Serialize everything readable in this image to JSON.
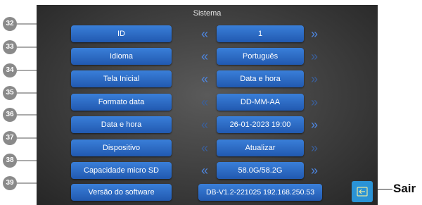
{
  "screen": {
    "title": "Sistema"
  },
  "rows": [
    {
      "callout": "32",
      "label": "ID",
      "value": "1"
    },
    {
      "callout": "33",
      "label": "Idioma",
      "value": "Português"
    },
    {
      "callout": "34",
      "label": "Tela Inicial",
      "value": "Data e hora"
    },
    {
      "callout": "35",
      "label": "Formato data",
      "value": "DD-MM-AA"
    },
    {
      "callout": "36",
      "label": "Data e hora",
      "value": "26-01-2023 19:00"
    },
    {
      "callout": "37",
      "label": "Dispositivo",
      "value": "Atualizar"
    },
    {
      "callout": "38",
      "label": "Capacidade micro SD",
      "value": "58.0G/58.2G"
    },
    {
      "callout": "39",
      "label": "Versão do software",
      "value": "DB-V1.2-221025 192.168.250.53"
    }
  ],
  "arrows": {
    "left": "«",
    "right": "»"
  },
  "exit": {
    "label": "Sair",
    "icon": "exit-icon"
  },
  "colors": {
    "button": "#2a6cc8",
    "arrow": "#4d86e0",
    "exit_button": "#2a93d6",
    "callout": "#8a8a8a"
  }
}
